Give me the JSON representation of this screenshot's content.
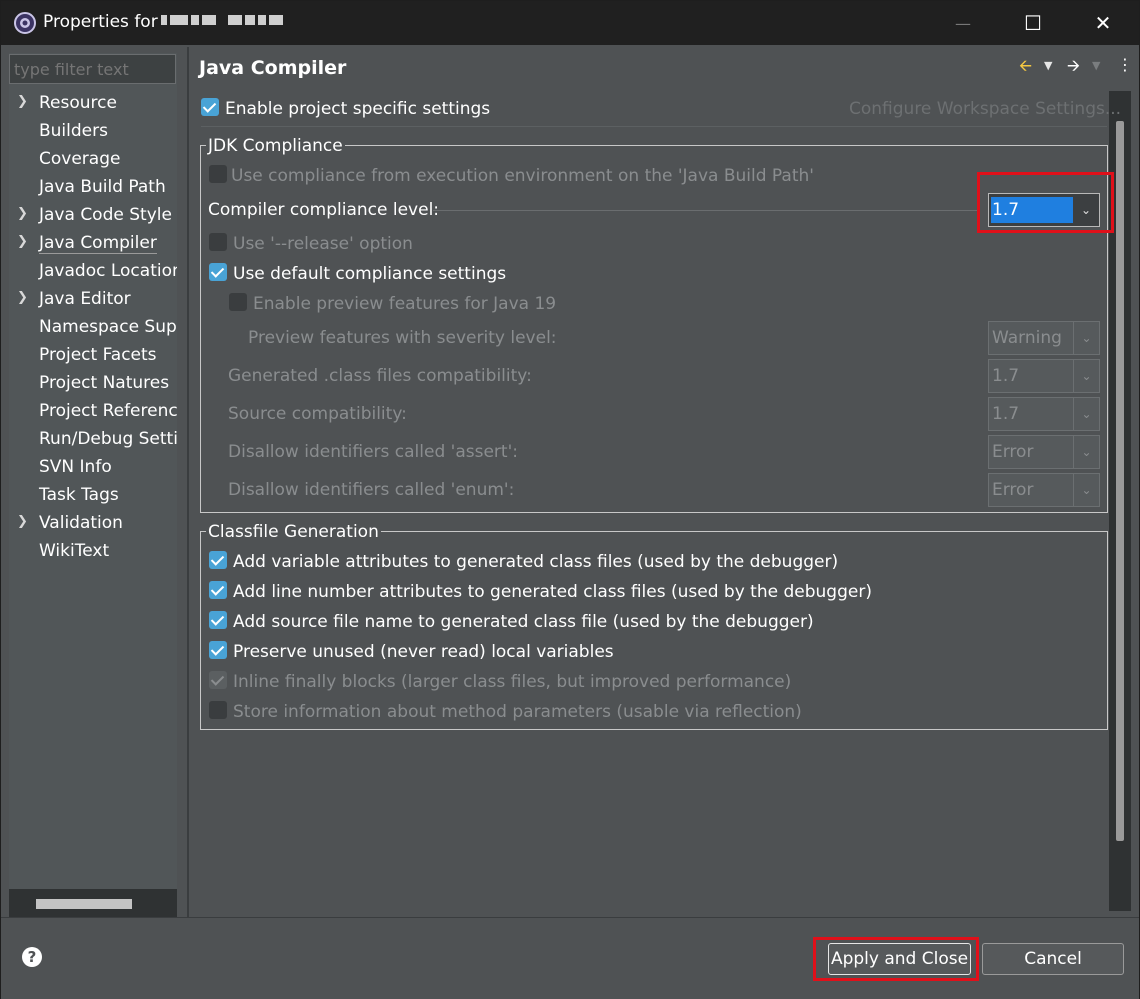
{
  "window": {
    "title": "Properties for",
    "minimize": "—",
    "maximize": "☐",
    "close": "✕"
  },
  "sidebar": {
    "filter_placeholder": "type filter text",
    "items": [
      {
        "label": "Resource",
        "expandable": true
      },
      {
        "label": "Builders",
        "expandable": false
      },
      {
        "label": "Coverage",
        "expandable": false
      },
      {
        "label": "Java Build Path",
        "expandable": false
      },
      {
        "label": "Java Code Style",
        "expandable": true
      },
      {
        "label": "Java Compiler",
        "expandable": true,
        "selected": true
      },
      {
        "label": "Javadoc Location",
        "expandable": false
      },
      {
        "label": "Java Editor",
        "expandable": true
      },
      {
        "label": "Namespace Supp",
        "expandable": false
      },
      {
        "label": "Project Facets",
        "expandable": false
      },
      {
        "label": "Project Natures",
        "expandable": false
      },
      {
        "label": "Project Reference",
        "expandable": false
      },
      {
        "label": "Run/Debug Setti",
        "expandable": false
      },
      {
        "label": "SVN Info",
        "expandable": false
      },
      {
        "label": "Task Tags",
        "expandable": false
      },
      {
        "label": "Validation",
        "expandable": true
      },
      {
        "label": "WikiText",
        "expandable": false
      }
    ]
  },
  "page": {
    "title": "Java Compiler",
    "enable_specific": "Enable project specific settings",
    "configure_link": "Configure Workspace Settings..."
  },
  "jdk": {
    "group_title": "JDK Compliance",
    "use_exec_env": "Use compliance from execution environment on the 'Java Build Path'",
    "compliance_label": "Compiler compliance level:",
    "compliance_value": "1.7",
    "use_release": "Use '--release' option",
    "use_default": "Use default compliance settings",
    "enable_preview": "Enable preview features for Java 19",
    "preview_severity_label": "Preview features with severity level:",
    "preview_severity_value": "Warning",
    "class_compat_label": "Generated .class files compatibility:",
    "class_compat_value": "1.7",
    "source_compat_label": "Source compatibility:",
    "source_compat_value": "1.7",
    "assert_label": "Disallow identifiers called 'assert':",
    "assert_value": "Error",
    "enum_label": "Disallow identifiers called 'enum':",
    "enum_value": "Error"
  },
  "classfile": {
    "group_title": "Classfile Generation",
    "opt_variable": "Add variable attributes to generated class files (used by the debugger)",
    "opt_line": "Add line number attributes to generated class files (used by the debugger)",
    "opt_source": "Add source file name to generated class file (used by the debugger)",
    "opt_preserve": "Preserve unused (never read) local variables",
    "opt_inline": "Inline finally blocks (larger class files, but improved performance)",
    "opt_store": "Store information about method parameters (usable via reflection)"
  },
  "footer": {
    "help": "?",
    "apply_close": "Apply and Close",
    "cancel": "Cancel"
  },
  "colors": {
    "highlight": "#e0101a",
    "checkbox": "#49a3d6",
    "selection": "#1f7fe0"
  }
}
